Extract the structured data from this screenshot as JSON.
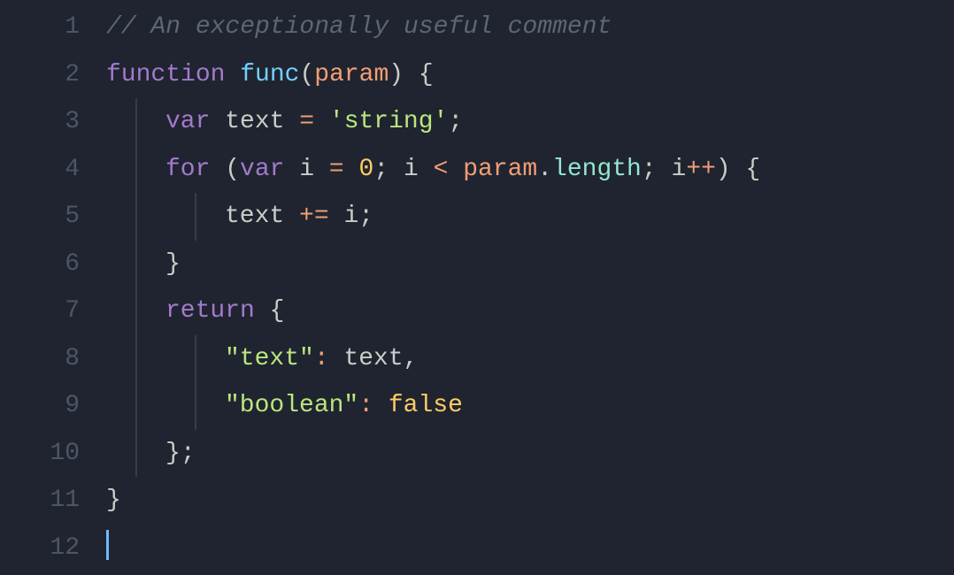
{
  "editor": {
    "line_numbers": [
      "1",
      "2",
      "3",
      "4",
      "5",
      "6",
      "7",
      "8",
      "9",
      "10",
      "11",
      "12"
    ],
    "colors": {
      "background": "#1f2430",
      "gutter": "#4d5566",
      "comment": "#5c6773",
      "keyword": "#a37acc",
      "function": "#73d0ff",
      "param": "#f29e74",
      "ident": "#cbccc6",
      "operator": "#f29e74",
      "string": "#bae67e",
      "number": "#ffcc66",
      "bool": "#ffcc66",
      "property": "#95e6cb",
      "indent_guide": "#363c4a",
      "cursor": "#73b8ff"
    },
    "lines": [
      {
        "indent": 0,
        "tokens": [
          {
            "t": "comment",
            "v": "// An exceptionally useful comment"
          }
        ]
      },
      {
        "indent": 0,
        "tokens": [
          {
            "t": "keyword",
            "v": "function"
          },
          {
            "t": "space",
            "v": " "
          },
          {
            "t": "funcname",
            "v": "func"
          },
          {
            "t": "punc",
            "v": "("
          },
          {
            "t": "param",
            "v": "param"
          },
          {
            "t": "punc",
            "v": ")"
          },
          {
            "t": "space",
            "v": " "
          },
          {
            "t": "punc",
            "v": "{"
          }
        ]
      },
      {
        "indent": 1,
        "tokens": [
          {
            "t": "keyword",
            "v": "var"
          },
          {
            "t": "space",
            "v": " "
          },
          {
            "t": "ident",
            "v": "text"
          },
          {
            "t": "space",
            "v": " "
          },
          {
            "t": "operator",
            "v": "="
          },
          {
            "t": "space",
            "v": " "
          },
          {
            "t": "string",
            "v": "'string'"
          },
          {
            "t": "punc",
            "v": ";"
          }
        ]
      },
      {
        "indent": 1,
        "tokens": [
          {
            "t": "keyword",
            "v": "for"
          },
          {
            "t": "space",
            "v": " "
          },
          {
            "t": "punc",
            "v": "("
          },
          {
            "t": "keyword",
            "v": "var"
          },
          {
            "t": "space",
            "v": " "
          },
          {
            "t": "ident",
            "v": "i"
          },
          {
            "t": "space",
            "v": " "
          },
          {
            "t": "operator",
            "v": "="
          },
          {
            "t": "space",
            "v": " "
          },
          {
            "t": "number",
            "v": "0"
          },
          {
            "t": "punc",
            "v": ";"
          },
          {
            "t": "space",
            "v": " "
          },
          {
            "t": "ident",
            "v": "i"
          },
          {
            "t": "space",
            "v": " "
          },
          {
            "t": "operator",
            "v": "<"
          },
          {
            "t": "space",
            "v": " "
          },
          {
            "t": "param",
            "v": "param"
          },
          {
            "t": "punc",
            "v": "."
          },
          {
            "t": "prop",
            "v": "length"
          },
          {
            "t": "punc",
            "v": ";"
          },
          {
            "t": "space",
            "v": " "
          },
          {
            "t": "ident",
            "v": "i"
          },
          {
            "t": "operator",
            "v": "++"
          },
          {
            "t": "punc",
            "v": ")"
          },
          {
            "t": "space",
            "v": " "
          },
          {
            "t": "punc",
            "v": "{"
          }
        ]
      },
      {
        "indent": 2,
        "tokens": [
          {
            "t": "ident",
            "v": "text"
          },
          {
            "t": "space",
            "v": " "
          },
          {
            "t": "operator",
            "v": "+="
          },
          {
            "t": "space",
            "v": " "
          },
          {
            "t": "ident",
            "v": "i"
          },
          {
            "t": "punc",
            "v": ";"
          }
        ]
      },
      {
        "indent": 1,
        "tokens": [
          {
            "t": "punc",
            "v": "}"
          }
        ]
      },
      {
        "indent": 1,
        "tokens": [
          {
            "t": "keyword",
            "v": "return"
          },
          {
            "t": "space",
            "v": " "
          },
          {
            "t": "punc",
            "v": "{"
          }
        ]
      },
      {
        "indent": 2,
        "tokens": [
          {
            "t": "string",
            "v": "\"text\""
          },
          {
            "t": "operator",
            "v": ":"
          },
          {
            "t": "space",
            "v": " "
          },
          {
            "t": "ident",
            "v": "text"
          },
          {
            "t": "punc",
            "v": ","
          }
        ]
      },
      {
        "indent": 2,
        "tokens": [
          {
            "t": "string",
            "v": "\"boolean\""
          },
          {
            "t": "operator",
            "v": ":"
          },
          {
            "t": "space",
            "v": " "
          },
          {
            "t": "bool",
            "v": "false"
          }
        ]
      },
      {
        "indent": 1,
        "tokens": [
          {
            "t": "punc",
            "v": "}"
          },
          {
            "t": "punc",
            "v": ";"
          }
        ]
      },
      {
        "indent": 0,
        "tokens": [
          {
            "t": "punc",
            "v": "}"
          }
        ]
      },
      {
        "indent": 0,
        "cursor": true,
        "tokens": []
      }
    ]
  }
}
